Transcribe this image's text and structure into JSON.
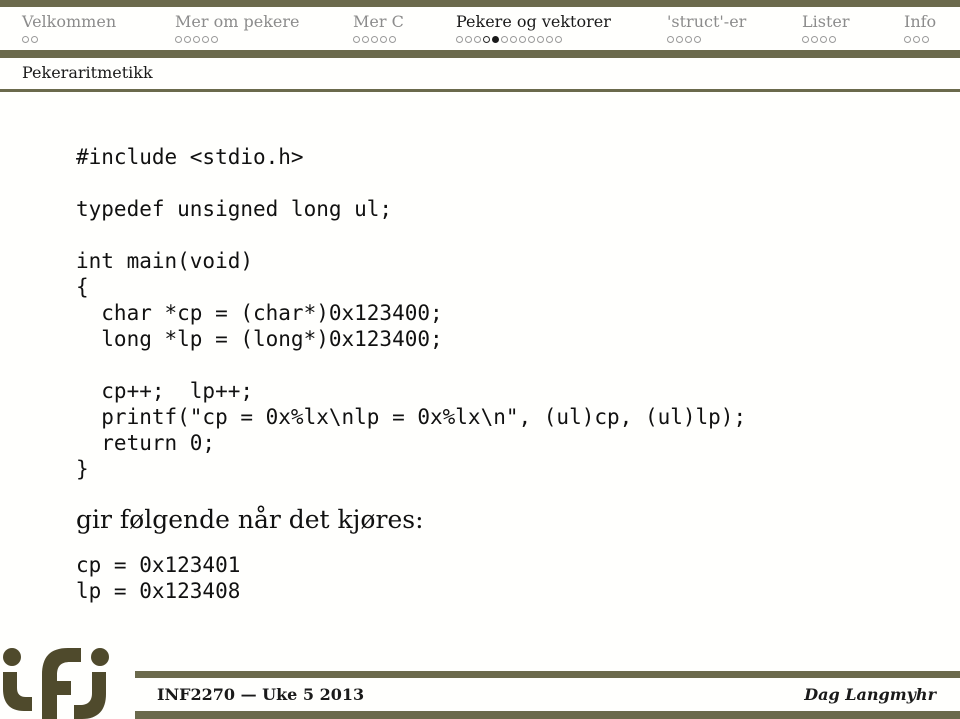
{
  "theme": {
    "accent": "#6b6a4c",
    "inactive_text": "#8c8c8c",
    "text": "#1a1a1a"
  },
  "nav": {
    "sections": [
      {
        "label": "Velkommen",
        "current": false,
        "dots": [
          "o",
          "o"
        ]
      },
      {
        "label": "Mer om pekere",
        "current": false,
        "dots": [
          "o",
          "o",
          "o",
          "o",
          "o"
        ]
      },
      {
        "label": "Mer C",
        "current": false,
        "dots": [
          "o",
          "o",
          "o",
          "o",
          "o"
        ]
      },
      {
        "label": "Pekere og vektorer",
        "current": true,
        "dots": [
          "o",
          "o",
          "o",
          "seen",
          "active",
          "o",
          "o",
          "o",
          "o",
          "o",
          "o",
          "o"
        ]
      },
      {
        "label": "'struct'-er",
        "current": false,
        "dots": [
          "o",
          "o",
          "o",
          "o"
        ]
      },
      {
        "label": "Lister",
        "current": false,
        "dots": [
          "o",
          "o",
          "o",
          "o"
        ]
      },
      {
        "label": "Info",
        "current": false,
        "dots": [
          "o",
          "o",
          "o"
        ]
      }
    ]
  },
  "frame": {
    "title": "Pekeraritmetikk"
  },
  "code": {
    "lines": [
      "#include <stdio.h>",
      "",
      "typedef unsigned long ul;",
      "",
      "int main(void)",
      "{",
      "  char *cp = (char*)0x123400;",
      "  long *lp = (long*)0x123400;",
      "",
      "  cp++;  lp++;",
      "  printf(\"cp = 0x%lx\\nlp = 0x%lx\\n\", (ul)cp, (ul)lp);",
      "  return 0;",
      "}"
    ]
  },
  "prose": "gir følgende når det kjøres:",
  "output": {
    "lines": [
      "cp = 0x123401",
      "lp = 0x123408"
    ]
  },
  "footer": {
    "logo": "ifi-logo",
    "left": "INF2270 — Uke 5 2013",
    "right": "Dag Langmyhr"
  }
}
